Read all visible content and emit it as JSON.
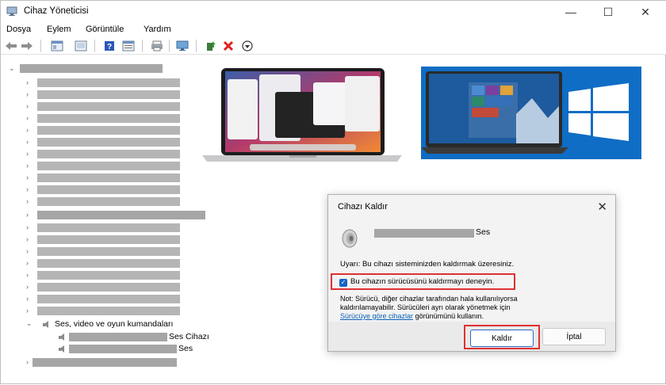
{
  "window": {
    "title": "Cihaz Yöneticisi",
    "controls": {
      "minimize": "—",
      "maximize": "☐",
      "close": "✕"
    }
  },
  "menu": {
    "items": [
      "Dosya",
      "Eylem",
      "Görüntüle",
      "Yardım"
    ]
  },
  "toolbar": {
    "icons": [
      "back-arrow-icon",
      "forward-arrow-icon",
      "properties-icon",
      "console-icon",
      "help-icon",
      "details-icon",
      "print-icon",
      "monitor-icon",
      "update-driver-icon",
      "uninstall-icon",
      "download-icon"
    ]
  },
  "tree": {
    "category_label": "Ses, video ve oyun kumandaları",
    "child_1_suffix": "Ses Cihazı",
    "child_2_suffix": "Ses"
  },
  "dialog": {
    "title": "Cihazı Kaldır",
    "close_symbol": "✕",
    "device_suffix": "Ses",
    "warning": "Uyarı: Bu cihazı sisteminizden kaldırmak üzeresiniz.",
    "checkbox_label": "Bu cihazın sürücüsünü kaldırmayı deneyin.",
    "checkbox_checked": true,
    "note_line1": "Not: Sürücü, diğer cihazlar tarafından hala kullanılıyorsa",
    "note_line2": "kaldırılamayabilir. Sürücüleri ayrı olarak yönetmek için",
    "note_link": "Sürücüye göre cihazlar",
    "note_after_link": " görünümünü kullanın.",
    "remove_button": "Kaldır",
    "cancel_button": "İptal"
  },
  "colors": {
    "highlight_red": "#e03131",
    "checkbox_blue": "#1464c8",
    "link_blue": "#0b5fb6",
    "windows_blue": "#0f6dc5"
  }
}
